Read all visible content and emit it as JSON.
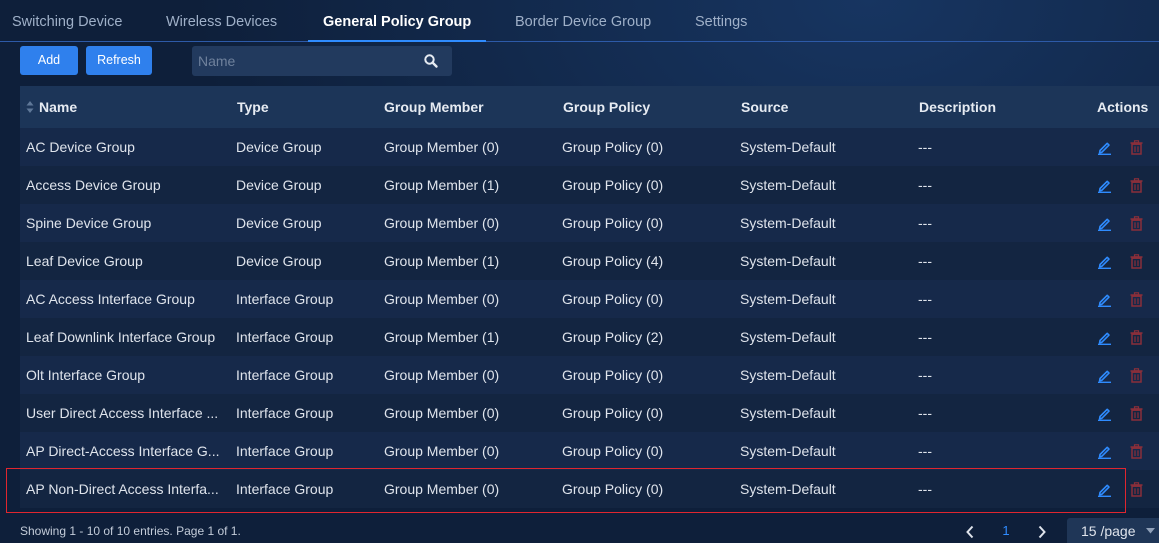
{
  "tabs": [
    {
      "label": "Switching Device"
    },
    {
      "label": "Wireless Devices"
    },
    {
      "label": "General Policy Group"
    },
    {
      "label": "Border Device Group"
    },
    {
      "label": "Settings"
    }
  ],
  "active_tab": "General Policy Group",
  "toolbar": {
    "add_label": "Add",
    "refresh_label": "Refresh",
    "search_placeholder": "Name",
    "search_value": ""
  },
  "table": {
    "columns": [
      "Name",
      "Type",
      "Group Member",
      "Group Policy",
      "Source",
      "Description",
      "Actions"
    ],
    "rows": [
      {
        "name": "AC Device Group",
        "type": "Device Group",
        "member": "Group Member (0)",
        "policy": "Group Policy (0)",
        "source": "System-Default",
        "description": "---"
      },
      {
        "name": "Access Device Group",
        "type": "Device Group",
        "member": "Group Member (1)",
        "policy": "Group Policy (0)",
        "source": "System-Default",
        "description": "---"
      },
      {
        "name": "Spine Device Group",
        "type": "Device Group",
        "member": "Group Member (0)",
        "policy": "Group Policy (0)",
        "source": "System-Default",
        "description": "---"
      },
      {
        "name": "Leaf Device Group",
        "type": "Device Group",
        "member": "Group Member (1)",
        "policy": "Group Policy (4)",
        "source": "System-Default",
        "description": "---"
      },
      {
        "name": "AC Access Interface Group",
        "type": "Interface Group",
        "member": "Group Member (0)",
        "policy": "Group Policy (0)",
        "source": "System-Default",
        "description": "---"
      },
      {
        "name": "Leaf Downlink Interface Group",
        "type": "Interface Group",
        "member": "Group Member (1)",
        "policy": "Group Policy (2)",
        "source": "System-Default",
        "description": "---"
      },
      {
        "name": "Olt Interface Group",
        "type": "Interface Group",
        "member": "Group Member (0)",
        "policy": "Group Policy (0)",
        "source": "System-Default",
        "description": "---"
      },
      {
        "name": "User Direct Access Interface ...",
        "type": "Interface Group",
        "member": "Group Member (0)",
        "policy": "Group Policy (0)",
        "source": "System-Default",
        "description": "---"
      },
      {
        "name": "AP Direct-Access Interface G...",
        "type": "Interface Group",
        "member": "Group Member (0)",
        "policy": "Group Policy (0)",
        "source": "System-Default",
        "description": "---"
      },
      {
        "name": "AP Non-Direct Access Interfa...",
        "type": "Interface Group",
        "member": "Group Member (0)",
        "policy": "Group Policy (0)",
        "source": "System-Default",
        "description": "---"
      }
    ]
  },
  "footer": {
    "info": "Showing 1 - 10 of 10 entries. Page 1 of 1.",
    "current_page": "1",
    "page_size": "15 /page"
  },
  "icons": {
    "sort": "sort-icon",
    "search": "search-icon",
    "edit": "pencil-icon",
    "delete": "trash-icon",
    "prev": "chevron-left-icon",
    "next": "chevron-right-icon",
    "dropdown": "caret-down-icon"
  },
  "colors": {
    "accent": "#2f80ed",
    "active_tab_underline": "#2f8cff",
    "edit_icon": "#2f8cff",
    "delete_icon": "#8a2f3a",
    "highlight_border": "#e0262f"
  }
}
